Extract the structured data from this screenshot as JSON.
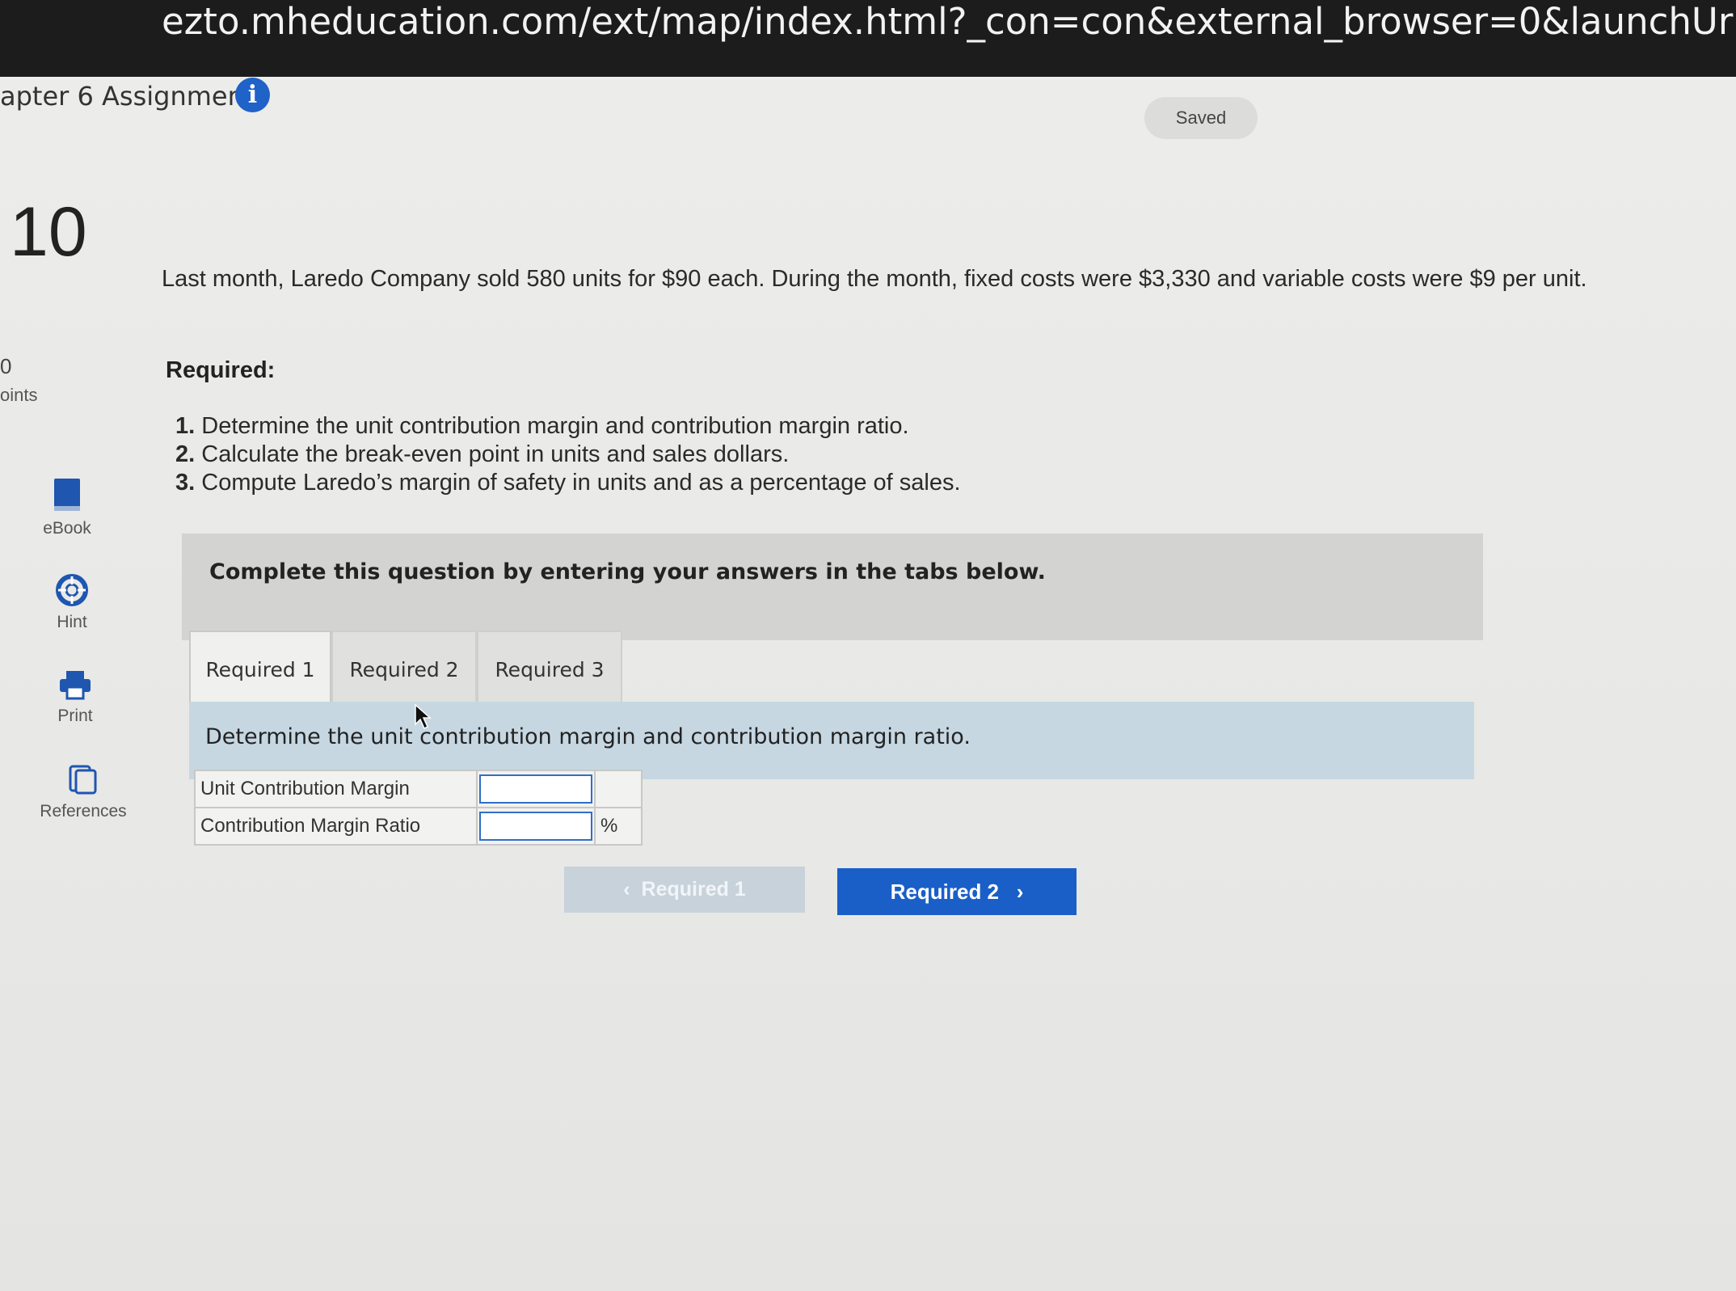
{
  "browser": {
    "url": "ezto.mheducation.com/ext/map/index.html?_con=con&external_browser=0&launchUrl=https%253A%252F%2"
  },
  "header": {
    "assignment_title": "apter 6 Assignment",
    "info_icon": "info-icon",
    "save_status": "Saved"
  },
  "question": {
    "number": "10",
    "points_value": "0",
    "points_label": "oints"
  },
  "side_tools": [
    {
      "label": "eBook",
      "icon": "book-icon"
    },
    {
      "label": "Hint",
      "icon": "lifebuoy-icon"
    },
    {
      "label": "Print",
      "icon": "printer-icon"
    },
    {
      "label": "References",
      "icon": "document-icon"
    }
  ],
  "problem": {
    "text": "Last month, Laredo Company sold 580 units for $90 each. During the month, fixed costs were $3,330 and variable costs were $9 per unit.",
    "required_heading": "Required:",
    "items": [
      {
        "num": "1.",
        "text": "Determine the unit contribution margin and contribution margin ratio."
      },
      {
        "num": "2.",
        "text": "Calculate the break-even point in units and sales dollars."
      },
      {
        "num": "3.",
        "text": "Compute Laredo’s margin of safety in units and as a percentage of sales."
      }
    ]
  },
  "answer_section": {
    "instruction_banner": "Complete this question by entering your answers in the tabs below.",
    "tabs": [
      "Required 1",
      "Required 2",
      "Required 3"
    ],
    "active_tab": "Required 1",
    "tab_instruction": "Determine the unit contribution margin and contribution margin ratio.",
    "rows": [
      {
        "label": "Unit Contribution Margin",
        "value": "",
        "unit": ""
      },
      {
        "label": "Contribution Margin Ratio",
        "value": "",
        "unit": "%"
      }
    ]
  },
  "navigation": {
    "prev_label": "Required 1",
    "next_label": "Required 2",
    "prev_icon": "chevron-left-icon",
    "next_icon": "chevron-right-icon"
  },
  "colors": {
    "accent_blue": "#1a5fc8",
    "instruction_bg": "#c6d7e2",
    "banner_bg": "#d3d3d1"
  }
}
